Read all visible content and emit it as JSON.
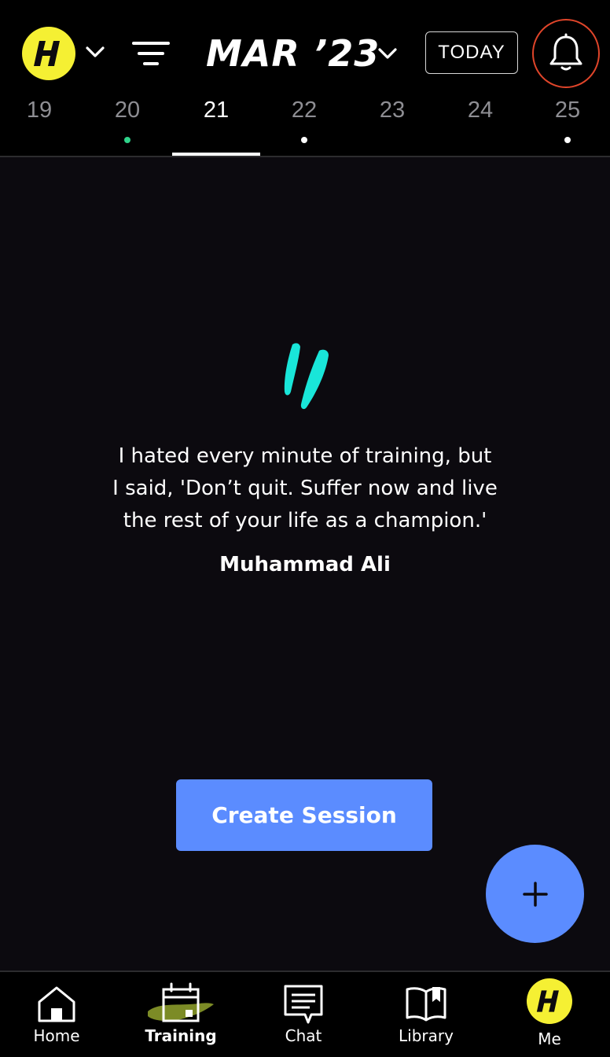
{
  "header": {
    "month_title": "MAR ’23",
    "today_label": "TODAY",
    "logo_letter": "H",
    "colors": {
      "logo_yellow": "#f5f033",
      "bell_highlight": "#e0452a",
      "dot_green": "#2fd38a"
    }
  },
  "days": [
    {
      "num": "19",
      "dot": null,
      "selected": false
    },
    {
      "num": "20",
      "dot": "#2fd38a",
      "selected": false
    },
    {
      "num": "21",
      "dot": null,
      "selected": true
    },
    {
      "num": "22",
      "dot": "#ffffff",
      "selected": false
    },
    {
      "num": "23",
      "dot": null,
      "selected": false
    },
    {
      "num": "24",
      "dot": null,
      "selected": false
    },
    {
      "num": "25",
      "dot": "#ffffff",
      "selected": false
    }
  ],
  "quote": {
    "line1": "I hated every minute of training, but",
    "line2": "I said, 'Don’t quit. Suffer now and live",
    "line3": "the rest of your life as a champion.'",
    "author": "Muhammad Ali",
    "mark_color": "#19e6d9"
  },
  "actions": {
    "create_session_label": "Create Session",
    "fab_symbol": "+",
    "accent_color": "#5b8cff"
  },
  "nav": {
    "items": [
      {
        "label": "Home",
        "icon": "home-icon",
        "active": false
      },
      {
        "label": "Training",
        "icon": "calendar-icon",
        "active": true
      },
      {
        "label": "Chat",
        "icon": "chat-icon",
        "active": false
      },
      {
        "label": "Library",
        "icon": "book-icon",
        "active": false
      },
      {
        "label": "Me",
        "icon": "avatar",
        "active": false
      }
    ],
    "active_highlight_color": "#8a9a2a"
  }
}
